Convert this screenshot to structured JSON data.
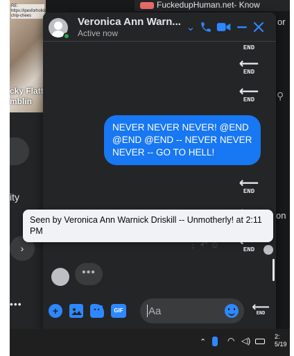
{
  "background": {
    "thumb_text_top": "RE: https://ipesforholidays.co/olate-chip-chees",
    "thumb_text_bottom": "cky Flatt\nmblin",
    "left_text": "ity",
    "left_dots": "•••",
    "top_tab": "FuckedupHuman.net- Know",
    "right_text_top": "or",
    "right_text_mid": "on"
  },
  "chat": {
    "contact_name": "Veronica Ann Warn...",
    "status": "Active now",
    "message": "NEVER NEVER NEVER! @END @END @END -- NEVER NEVER NEVER -- GO TO HELL!",
    "end_label": "END",
    "typing_dots": "•••",
    "input_placeholder": "Aa",
    "gif_label": "GIF"
  },
  "tooltip": {
    "text": "Seen by Veronica Ann Warnick Driskill -- Unmotherly! at 2:11 PM"
  },
  "taskbar": {
    "time": "2:",
    "date": "5/19"
  },
  "colors": {
    "accent": "#2d88ff",
    "bubble": "#1877f2",
    "chat_bg": "#242526",
    "online": "#31a24c"
  }
}
